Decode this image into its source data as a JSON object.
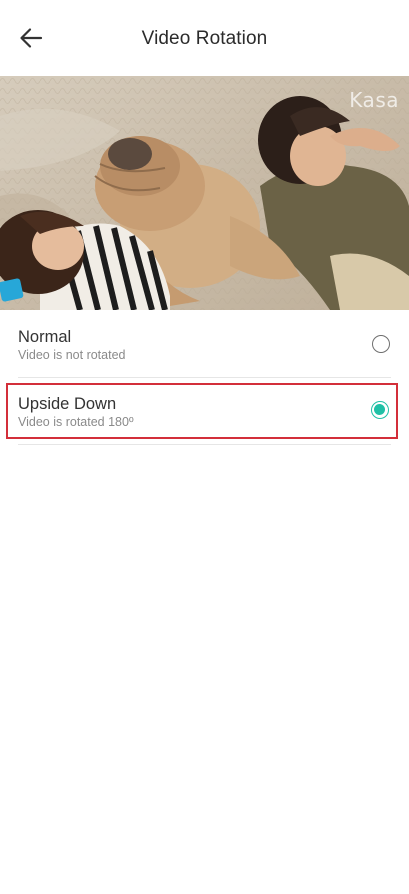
{
  "header": {
    "title": "Video Rotation",
    "back_icon": "arrow-left-icon"
  },
  "preview": {
    "watermark": "Kasa"
  },
  "options": [
    {
      "title": "Normal",
      "subtitle": "Video is not rotated",
      "selected": false
    },
    {
      "title": "Upside Down",
      "subtitle": "Video is rotated 180º",
      "selected": true
    }
  ],
  "colors": {
    "accent": "#1fc0a6",
    "highlight_border": "#d32f3a",
    "title_text": "#2b2b2b",
    "subtitle_text": "#8a8a8a"
  }
}
